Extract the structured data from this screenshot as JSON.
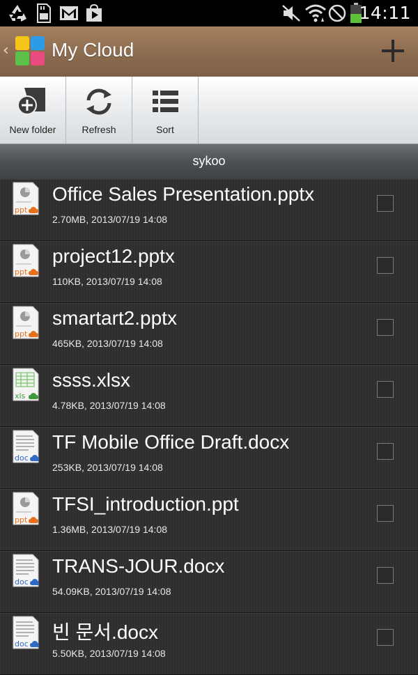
{
  "status_bar": {
    "time": "14:11",
    "icons": [
      "recycle-icon",
      "sd-card-icon",
      "gmail-icon",
      "play-store-icon",
      "mute-icon",
      "wifi-icon",
      "no-signal-icon",
      "battery-icon"
    ]
  },
  "title_bar": {
    "back_glyph": "‹",
    "title": "My Cloud",
    "add_icon": "plus-icon"
  },
  "toolbar": {
    "new_folder_label": "New folder",
    "refresh_label": "Refresh",
    "sort_label": "Sort"
  },
  "section": {
    "title": "sykoo"
  },
  "files": [
    {
      "name": "Office Sales Presentation.pptx",
      "meta": "2.70MB, 2013/07/19 14:08",
      "type": "ppt"
    },
    {
      "name": "project12.pptx",
      "meta": "110KB, 2013/07/19 14:08",
      "type": "ppt"
    },
    {
      "name": "smartart2.pptx",
      "meta": "465KB, 2013/07/19 14:08",
      "type": "ppt"
    },
    {
      "name": "ssss.xlsx",
      "meta": "4.78KB, 2013/07/19 14:08",
      "type": "xls"
    },
    {
      "name": "TF Mobile Office Draft.docx",
      "meta": "253KB, 2013/07/19 14:08",
      "type": "doc"
    },
    {
      "name": "TFSI_introduction.ppt",
      "meta": "1.36MB, 2013/07/19 14:08",
      "type": "ppt"
    },
    {
      "name": "TRANS-JOUR.docx",
      "meta": "54.09KB, 2013/07/19 14:08",
      "type": "doc"
    },
    {
      "name": "빈 문서.docx",
      "meta": "5.50KB, 2013/07/19 14:08",
      "type": "doc"
    }
  ],
  "colors": {
    "ppt_accent": "#e8701a",
    "xls_accent": "#3c9a3c",
    "doc_accent": "#2f6ac3",
    "battery": "#5fc13a"
  }
}
